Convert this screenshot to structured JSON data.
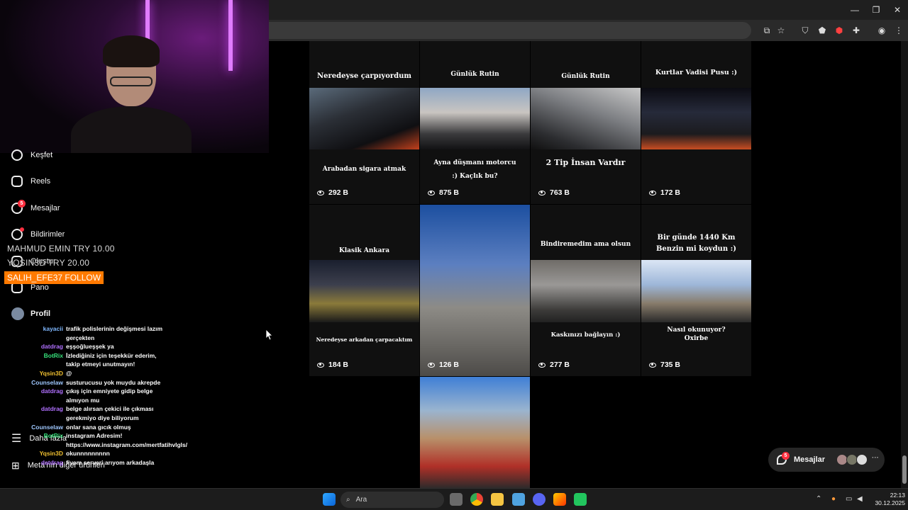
{
  "browser": {
    "window_controls": [
      "—",
      "❐",
      "✕"
    ]
  },
  "sidebar": {
    "items": [
      {
        "label": "Keşfet"
      },
      {
        "label": "Reels"
      },
      {
        "label": "Mesajlar",
        "badge": "5"
      },
      {
        "label": "Bildirimler"
      },
      {
        "label": "Oluştur"
      },
      {
        "label": "Pano"
      },
      {
        "label": "Profil"
      },
      {
        "label": "Daha fazla"
      },
      {
        "label": "Meta'nın diğer ürünleri"
      }
    ]
  },
  "stream_overlay": {
    "donations": [
      "MAHMUD EMIN  TRY 10.00",
      "YQSIN3D  TRY 20.00"
    ],
    "follow_alert": "SALIH_EFE37  FOLLOW"
  },
  "chat": [
    {
      "user": "kayacii",
      "color": "#7fb8ff",
      "msg": "trafik polislerinin değişmesi lazım gerçekten"
    },
    {
      "user": "datdrag",
      "color": "#b070ff",
      "msg": "eşşoğlueşşek ya"
    },
    {
      "user": "BotRix",
      "color": "#36e07a",
      "msg": "İzlediğiniz için teşekkür ederim, takip etmeyi unutmayın!"
    },
    {
      "user": "Yqsin3D",
      "color": "#f0c030",
      "msg": "@"
    },
    {
      "user": "Counselaw",
      "color": "#9fc8ff",
      "msg": "susturucusu yok muydu akrepde"
    },
    {
      "user": "datdrag",
      "color": "#b070ff",
      "msg": "çıkış için emniyete gidip belge almıyon mu"
    },
    {
      "user": "datdrag",
      "color": "#b070ff",
      "msg": "belge alırsan çekici ile çıkması gerekmiyo diye biliyorum"
    },
    {
      "user": "Counselaw",
      "color": "#9fc8ff",
      "msg": "onlar sana gıcık olmuş"
    },
    {
      "user": "BotRix",
      "color": "#36e07a",
      "msg": "instagram Adresim! https://www.instagram.com/mertfatihvlgls/"
    },
    {
      "user": "Yqsin3D",
      "color": "#f0c030",
      "msg": "okunnnnnnnnn"
    },
    {
      "user": "datdrag",
      "color": "#b070ff",
      "msg": "fivem serveri arıyom arkadaşla"
    }
  ],
  "reels": [
    {
      "top_title": "Neredeyse çarpıyordum",
      "bottom_title": "Arabadan sigara atmak",
      "views": "292 B"
    },
    {
      "top_title": "Günlük Rutin",
      "bottom_title": "Ayna düşmanı motorcu :) Kaçlık bu?",
      "views": "875 B"
    },
    {
      "top_title": "Günlük Rutin",
      "bottom_title": "2 Tip İnsan Vardır",
      "views": "763 B"
    },
    {
      "top_title": "Kurtlar Vadisi Pusu :)",
      "bottom_title": "",
      "views": "172 B"
    },
    {
      "top_title": "Klasik Ankara",
      "bottom_title": "Neredeyse arkadan çarpacaktım",
      "views": "184 B"
    },
    {
      "top_title": "",
      "bottom_title": "",
      "views": "126 B"
    },
    {
      "top_title": "Bindiremedim ama olsun",
      "bottom_title": "Kaskınızı bağlayın :)",
      "views": "277 B"
    },
    {
      "top_title": "Bir günde 1440 Km Benzin mi koydun :)",
      "bottom_title": "Nasıl okunuyor? Oxirbe",
      "views": "735 B"
    }
  ],
  "floating_messages": {
    "label": "Mesajlar",
    "badge": "5"
  },
  "taskbar": {
    "search_placeholder": "Ara",
    "time": "22:13",
    "date": "30.12.2025"
  }
}
